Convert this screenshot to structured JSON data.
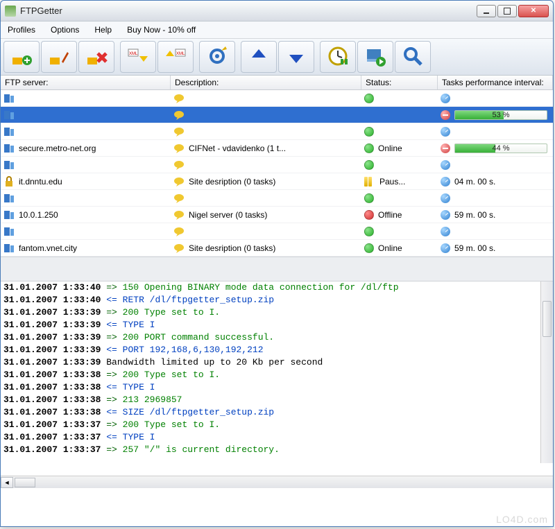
{
  "title": "FTPGetter",
  "menu": [
    "Profiles",
    "Options",
    "Help",
    "Buy Now - 10% off"
  ],
  "toolbar_icons": [
    "add-profile-icon",
    "edit-profile-icon",
    "delete-profile-icon",
    "import-xml-icon",
    "export-xml-icon",
    "settings-icon",
    "upload-icon",
    "download-icon",
    "scheduler-icon",
    "run-icon",
    "search-icon"
  ],
  "columns": {
    "server": "FTP server:",
    "description": "Description:",
    "status": "Status:",
    "tasks": "Tasks performance interval:"
  },
  "rows": [
    {
      "server": "",
      "server_icon": "server",
      "desc_icon": "balloon",
      "desc": "",
      "status_icon": "green",
      "status": "",
      "task_icon": "clock",
      "task": "",
      "progress": null
    },
    {
      "server": "",
      "server_icon": "server",
      "desc_icon": "balloon",
      "desc": "",
      "status_icon": "",
      "status": "",
      "task_icon": "stop",
      "task": "",
      "progress": 53,
      "selected": true
    },
    {
      "server": "",
      "server_icon": "server",
      "desc_icon": "balloon",
      "desc": "",
      "status_icon": "green",
      "status": "",
      "task_icon": "clock",
      "task": "",
      "progress": null
    },
    {
      "server": "secure.metro-net.org",
      "server_icon": "server",
      "desc_icon": "balloon",
      "desc": "CIFNet - vdavidenko (1 t...",
      "status_icon": "green",
      "status": "Online",
      "task_icon": "stop",
      "task": "",
      "progress": 44
    },
    {
      "server": "",
      "server_icon": "server",
      "desc_icon": "balloon",
      "desc": "",
      "status_icon": "green",
      "status": "",
      "task_icon": "clock",
      "task": "",
      "progress": null
    },
    {
      "server": "it.dnntu.edu",
      "server_icon": "lock",
      "desc_icon": "balloon",
      "desc": "Site desription (0 tasks)",
      "status_icon": "pause",
      "status": "Paus...",
      "task_icon": "clock",
      "task": "04 m. 00 s.",
      "progress": null
    },
    {
      "server": "",
      "server_icon": "server",
      "desc_icon": "balloon",
      "desc": "",
      "status_icon": "green",
      "status": "",
      "task_icon": "clock",
      "task": "",
      "progress": null
    },
    {
      "server": "10.0.1.250",
      "server_icon": "server",
      "desc_icon": "balloon",
      "desc": "Nigel server (0 tasks)",
      "status_icon": "red",
      "status": "Offline",
      "task_icon": "clock",
      "task": "59 m. 00 s.",
      "progress": null
    },
    {
      "server": "",
      "server_icon": "server",
      "desc_icon": "balloon",
      "desc": "",
      "status_icon": "green",
      "status": "",
      "task_icon": "clock",
      "task": "",
      "progress": null
    },
    {
      "server": "fantom.vnet.city",
      "server_icon": "server",
      "desc_icon": "balloon",
      "desc": "Site desription (0 tasks)",
      "status_icon": "green",
      "status": "Online",
      "task_icon": "clock",
      "task": "59 m. 00 s.",
      "progress": null
    }
  ],
  "log": [
    {
      "ts": "31.01.2007 1:33:40",
      "dir": "=>",
      "cls": "green",
      "msg": "150 Opening BINARY mode data connection for /dl/ftp"
    },
    {
      "ts": "31.01.2007 1:33:40",
      "dir": "<=",
      "cls": "blue",
      "msg": "RETR /dl/ftpgetter_setup.zip"
    },
    {
      "ts": "31.01.2007 1:33:39",
      "dir": "=>",
      "cls": "green",
      "msg": "200 Type set to I."
    },
    {
      "ts": "31.01.2007 1:33:39",
      "dir": "<=",
      "cls": "blue",
      "msg": "TYPE I"
    },
    {
      "ts": "31.01.2007 1:33:39",
      "dir": "=>",
      "cls": "green",
      "msg": "200 PORT command successful."
    },
    {
      "ts": "31.01.2007 1:33:39",
      "dir": "<=",
      "cls": "blue",
      "msg": "PORT 192,168,6,130,192,212"
    },
    {
      "ts": "31.01.2007 1:33:39",
      "dir": "",
      "cls": "black",
      "msg": "Bandwidth limited up to 20 Kb per second"
    },
    {
      "ts": "31.01.2007 1:33:38",
      "dir": "=>",
      "cls": "green",
      "msg": "200 Type set to I."
    },
    {
      "ts": "31.01.2007 1:33:38",
      "dir": "<=",
      "cls": "blue",
      "msg": "TYPE I"
    },
    {
      "ts": "31.01.2007 1:33:38",
      "dir": "=>",
      "cls": "green",
      "msg": "213 2969857"
    },
    {
      "ts": "31.01.2007 1:33:38",
      "dir": "<=",
      "cls": "blue",
      "msg": "SIZE /dl/ftpgetter_setup.zip"
    },
    {
      "ts": "31.01.2007 1:33:37",
      "dir": "=>",
      "cls": "green",
      "msg": "200 Type set to I."
    },
    {
      "ts": "31.01.2007 1:33:37",
      "dir": "<=",
      "cls": "blue",
      "msg": "TYPE I"
    },
    {
      "ts": "31.01.2007 1:33:37",
      "dir": "=>",
      "cls": "green",
      "msg": "257 \"/\" is current directory."
    }
  ],
  "watermark": "LO4D.com"
}
